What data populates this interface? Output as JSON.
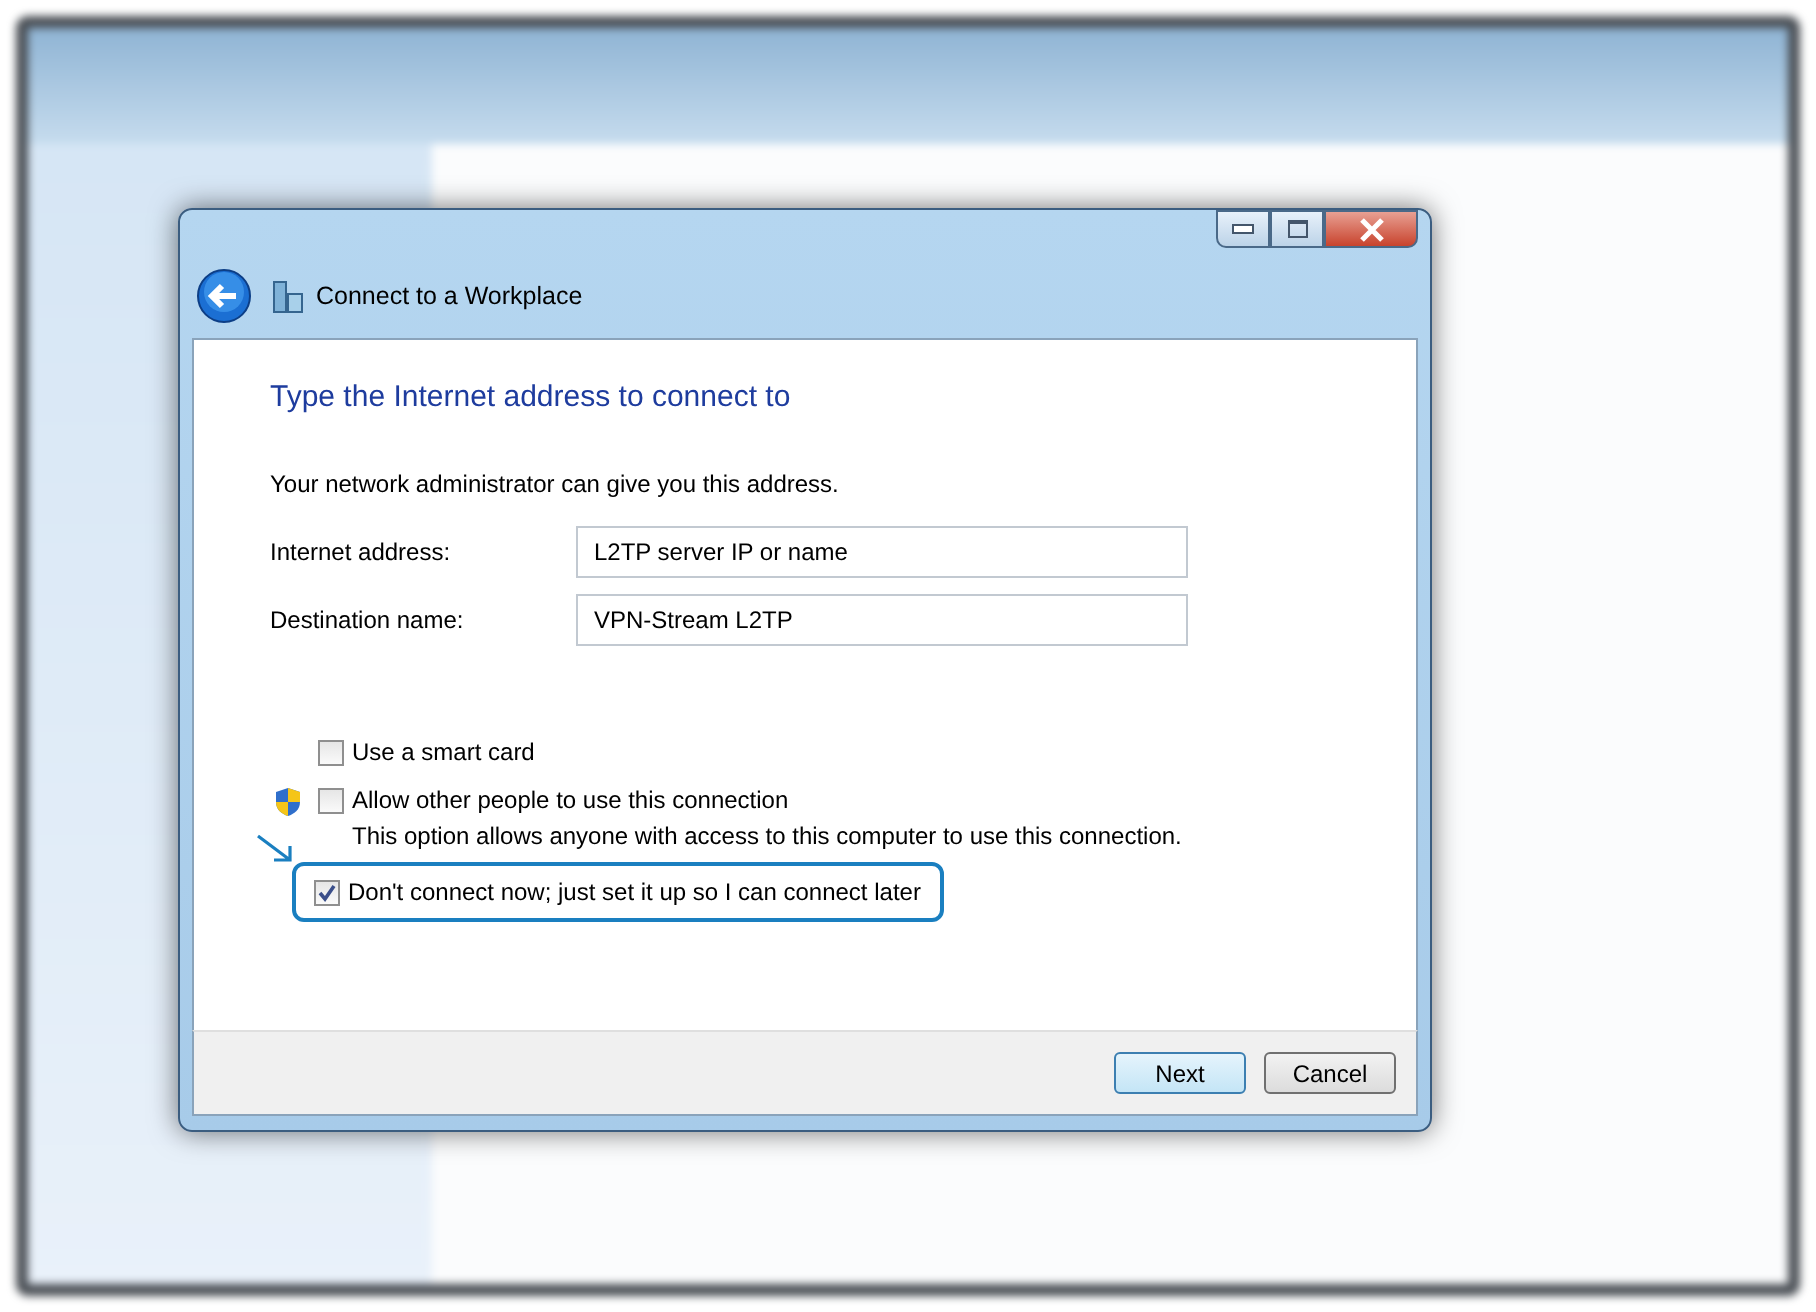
{
  "dialog": {
    "title": "Connect to a Workplace",
    "heading": "Type the Internet address to connect to",
    "intro": "Your network administrator can give you this address.",
    "fields": [
      {
        "label": "Internet address:",
        "value": "L2TP server IP or name"
      },
      {
        "label": "Destination name:",
        "value": "VPN-Stream L2TP"
      }
    ],
    "options": [
      {
        "label": "Use a smart card",
        "checked": false,
        "admin_shield": false,
        "highlighted": false
      },
      {
        "label": "Allow other people to use this connection",
        "checked": false,
        "admin_shield": true,
        "description": "This option allows anyone with access to this computer to use this connection.",
        "highlighted": false
      },
      {
        "label": "Don't connect now; just set it up so I can connect later",
        "checked": true,
        "admin_shield": false,
        "highlighted": true
      }
    ],
    "buttons": [
      {
        "label": "Next",
        "default": true
      },
      {
        "label": "Cancel",
        "default": false
      }
    ]
  }
}
